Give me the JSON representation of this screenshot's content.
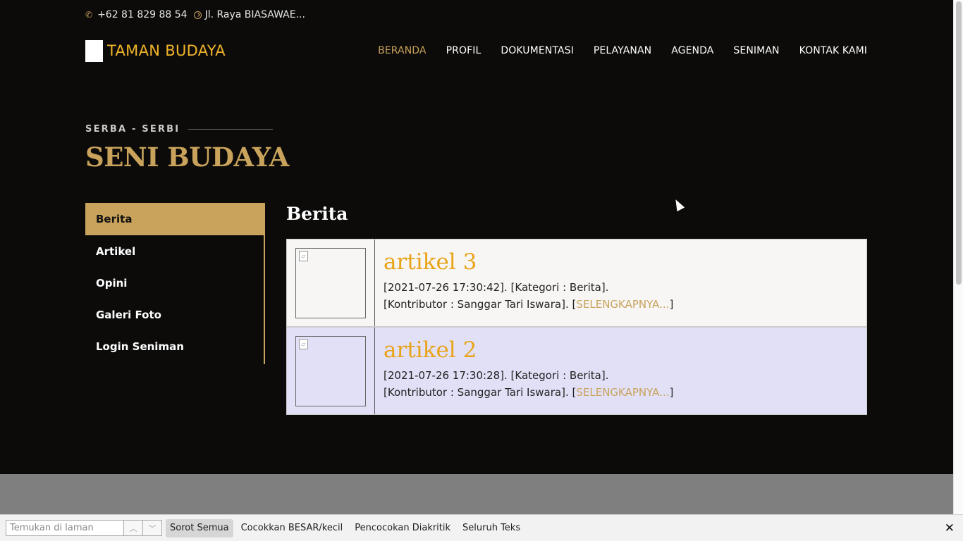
{
  "topbar": {
    "phone_icon": "phone-icon",
    "phone": "+62 81 829 88 54",
    "location_icon": "clock-icon",
    "address": "Jl. Raya BIASAWAE..."
  },
  "header": {
    "brand": "TAMAN BUDAYA",
    "nav": [
      "BERANDA",
      "PROFIL",
      "DOKUMENTASI",
      "PELAYANAN",
      "AGENDA",
      "SENIMAN",
      "KONTAK KAMI"
    ],
    "active_nav": "BERANDA"
  },
  "section": {
    "eyebrow": "SERBA - SERBI",
    "title": "SENI BUDAYA"
  },
  "sidebar": {
    "items": [
      "Berita",
      "Artikel",
      "Opini",
      "Galeri Foto",
      "Login Seniman"
    ],
    "active": "Berita"
  },
  "content": {
    "heading": "Berita",
    "posts": [
      {
        "title": "artikel 3",
        "meta_line1": "[2021-07-26 17:30:42]. [Kategori : Berita].",
        "meta_line2_prefix": "[Kontributor : Sanggar Tari Iswara]. [",
        "link": "SELENGKAPNYA...",
        "meta_line2_suffix": "]"
      },
      {
        "title": "artikel 2",
        "meta_line1": "[2021-07-26 17:30:28]. [Kategori : Berita].",
        "meta_line2_prefix": "[Kontributor : Sanggar Tari Iswara]. [",
        "link": "SELENGKAPNYA...",
        "meta_line2_suffix": "]"
      }
    ]
  },
  "findbar": {
    "placeholder": "Temukan di laman",
    "highlight_all": "Sorot Semua",
    "match_case": "Cocokkan BESAR/kecil",
    "match_diacritics": "Pencocokan Diakritik",
    "whole_words": "Seluruh Teks",
    "close": "✕"
  },
  "colors": {
    "accent": "#c9a35b",
    "brand": "#f0b429",
    "post_title": "#e8a317",
    "background": "#0c0b0a"
  }
}
